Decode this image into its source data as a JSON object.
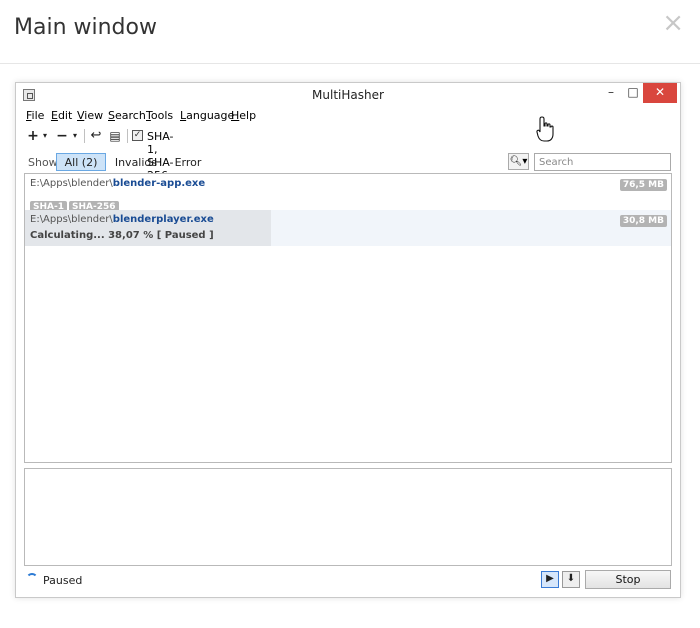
{
  "dialog": {
    "title": "Main window",
    "close_glyph": "×"
  },
  "window": {
    "title": "MultiHasher",
    "controls": {
      "minimize": "–",
      "maximize": "□",
      "close": "✕"
    }
  },
  "menu": [
    "File",
    "Edit",
    "View",
    "Search",
    "Tools",
    "Language",
    "Help"
  ],
  "toolbar": {
    "algorithms_label": "SHA-1, SHA-256",
    "algorithms_checked": true
  },
  "filter": {
    "show_label": "Show",
    "tabs": [
      "All (2)",
      "Invalids",
      "Error"
    ],
    "active_tab": "All (2)",
    "search_placeholder": "Search"
  },
  "files": [
    {
      "dir": "E:\\Apps\\blender\\",
      "name": "blender-app.exe",
      "size": "76,5 MB",
      "tags": [
        "SHA-1",
        "SHA-256"
      ]
    },
    {
      "dir": "E:\\Apps\\blender\\",
      "name": "blenderplayer.exe",
      "size": "30,8 MB",
      "status": "Calculating... 38,07 % [ Paused ]",
      "progress": 0.3807
    }
  ],
  "status": {
    "text": "Paused",
    "stop_label": "Stop"
  },
  "icons": {
    "app": "app-icon",
    "add": "plus-icon",
    "remove": "minus-icon",
    "undo": "undo-icon",
    "export": "export-icon",
    "search": "search-icon",
    "spinner": "spinner-icon",
    "play": "play-icon",
    "download": "download-icon",
    "cursor": "hand-cursor-icon"
  },
  "colors": {
    "accent": "#2d7bd4",
    "close_button": "#d9463e",
    "active_tab": "#cde3f8",
    "filename": "#1a4c94",
    "badge": "#b3b3b3"
  }
}
